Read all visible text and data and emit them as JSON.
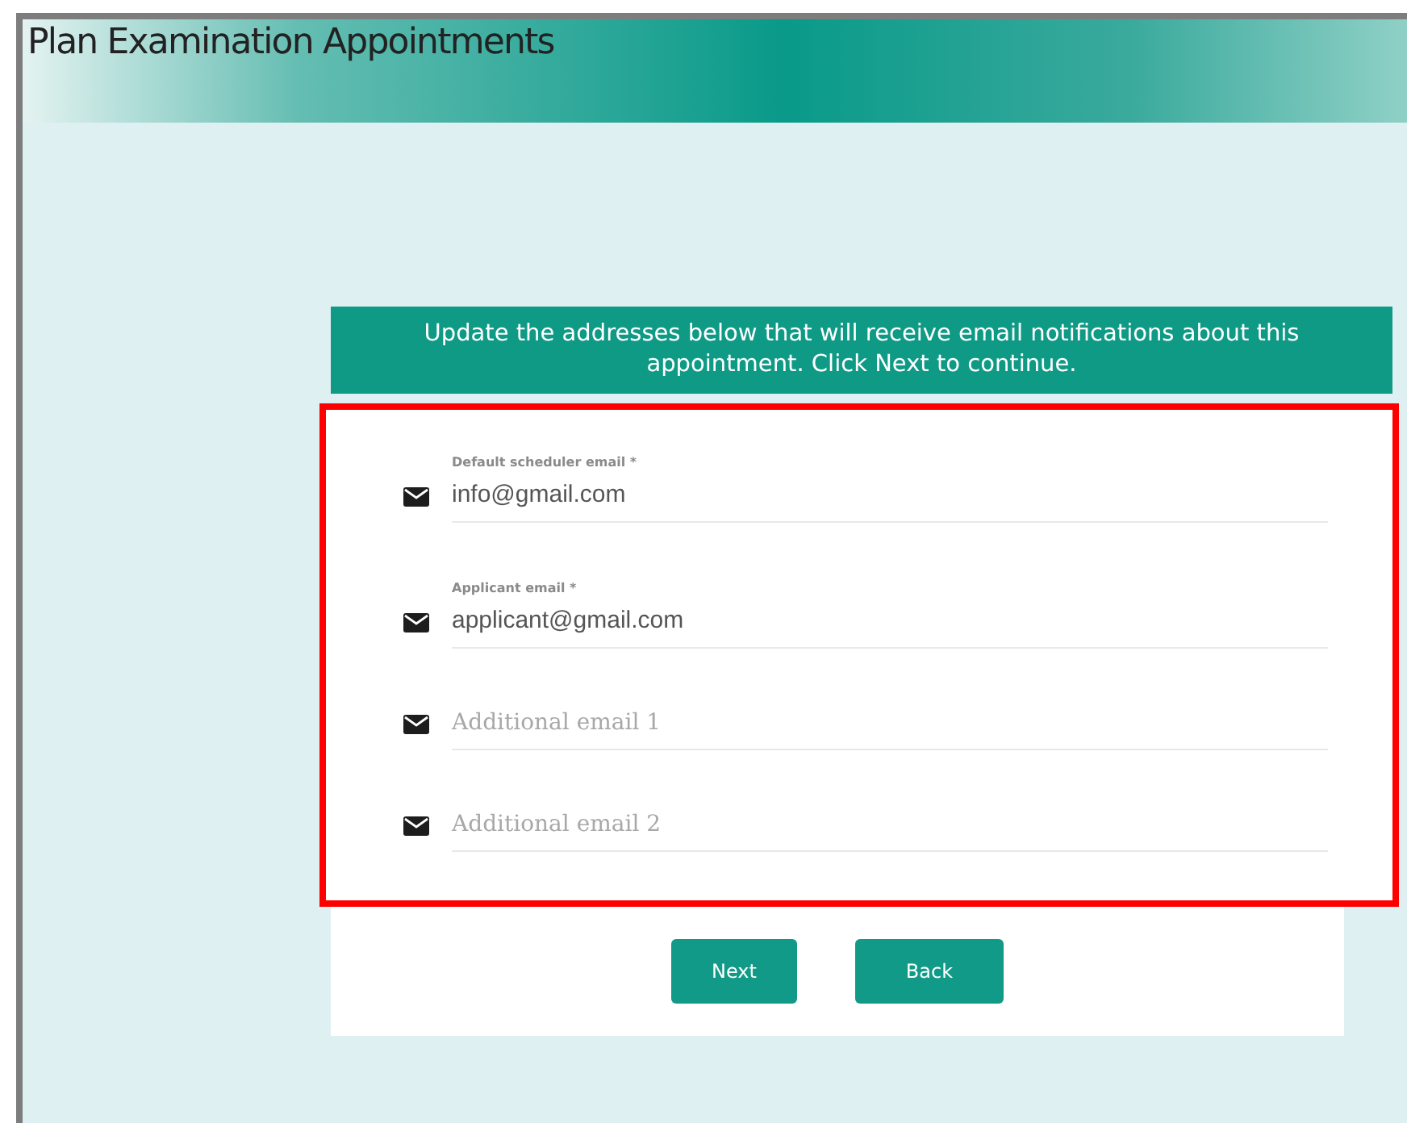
{
  "window": {
    "title": "Plan Examination Appointments"
  },
  "form": {
    "instructions": "Update the addresses below that will receive email notifications about this appointment. Click Next to continue.",
    "highlighted": true,
    "fields": [
      {
        "label": "Default scheduler email *",
        "value": "info@gmail.com"
      },
      {
        "label": "Applicant email *",
        "value": "applicant@gmail.com"
      },
      {
        "placeholder": "Additional email 1"
      },
      {
        "placeholder": "Additional email 2"
      }
    ]
  },
  "buttons": [
    "Next",
    "Back"
  ]
}
